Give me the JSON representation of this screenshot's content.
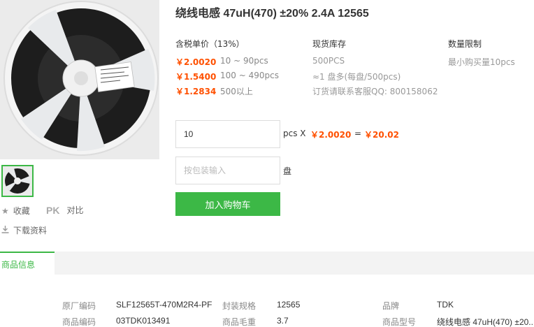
{
  "product": {
    "title": "绕线电感 47uH(470) ±20% 2.4A 12565",
    "image_alt": "tape-and-reel package"
  },
  "side_actions": {
    "favorite_label": "收藏",
    "compare_pk": "PK",
    "compare_label": "对比",
    "download_label": "下载资料"
  },
  "pricing": {
    "header": "含税单价（13%）",
    "tiers": [
      {
        "price": "￥2.0020",
        "qty": "10 ~ 90pcs"
      },
      {
        "price": "￥1.5400",
        "qty": "100 ~ 490pcs"
      },
      {
        "price": "￥1.2834",
        "qty": "500以上"
      }
    ]
  },
  "stock": {
    "header": "现货库存",
    "quantity": "500PCS",
    "reel_info": "≈1 盘多(每盘/500pcs)",
    "contact": "订货请联系客服QQ: 800158062"
  },
  "limit": {
    "header": "数量限制",
    "text": "最小购买量10pcs"
  },
  "order": {
    "qty_value": "10",
    "qty_unit": "pcs X",
    "unit_price": "￥2.0020",
    "equals": "=",
    "total": "￥20.02",
    "reel_placeholder": "按包装输入",
    "reel_unit": "盘",
    "add_to_cart": "加入购物车"
  },
  "tabs": {
    "active": "商品信息"
  },
  "attributes": {
    "rows": [
      [
        {
          "label": "原厂编码",
          "value": "SLF12565T-470M2R4-PF"
        },
        {
          "label": "封装规格",
          "value": "12565"
        },
        {
          "label": "品牌",
          "value": "TDK"
        }
      ],
      [
        {
          "label": "商品编码",
          "value": "03TDK013491"
        },
        {
          "label": "商品毛重",
          "value": "3.7"
        },
        {
          "label": "商品型号",
          "value": "绕线电感 47uH(470) ±20..."
        }
      ]
    ]
  },
  "colors": {
    "accent_green": "#3cb846",
    "price_orange": "#ff5000"
  }
}
